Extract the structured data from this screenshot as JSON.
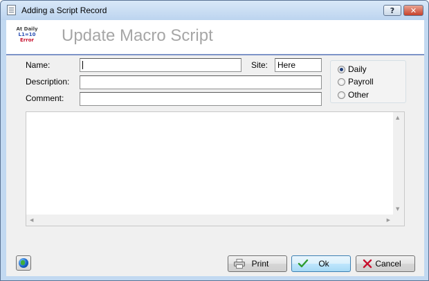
{
  "window": {
    "title": "Adding a Script Record",
    "help_symbol": "?",
    "close_symbol": "✕"
  },
  "header": {
    "logo_lines": [
      "At Daily",
      "L1=10",
      "Error"
    ],
    "title": "Update Macro Script"
  },
  "form": {
    "name_label": "Name:",
    "name_value": "",
    "site_label": "Site:",
    "site_value": "Here",
    "description_label": "Description:",
    "description_value": "",
    "comment_label": "Comment:",
    "comment_value": ""
  },
  "schedule": {
    "options": [
      "Daily",
      "Payroll",
      "Other"
    ],
    "selected": "Daily"
  },
  "script_editor": {
    "content": "",
    "up_arrow": "▲",
    "down_arrow": "▼",
    "left_arrow": "◀",
    "right_arrow": "▶"
  },
  "buttons": {
    "print": "Print",
    "ok": "Ok",
    "cancel": "Cancel"
  },
  "icons": {
    "app": "window-menu-icon",
    "globe": "globe-icon",
    "print": "printer-icon",
    "ok": "checkmark-icon",
    "cancel": "x-icon"
  },
  "colors": {
    "header_rule": "#7c93c7",
    "ok_check": "#2e9b2e",
    "cancel_x": "#c8102e",
    "title_text": "#a6a6a6"
  }
}
